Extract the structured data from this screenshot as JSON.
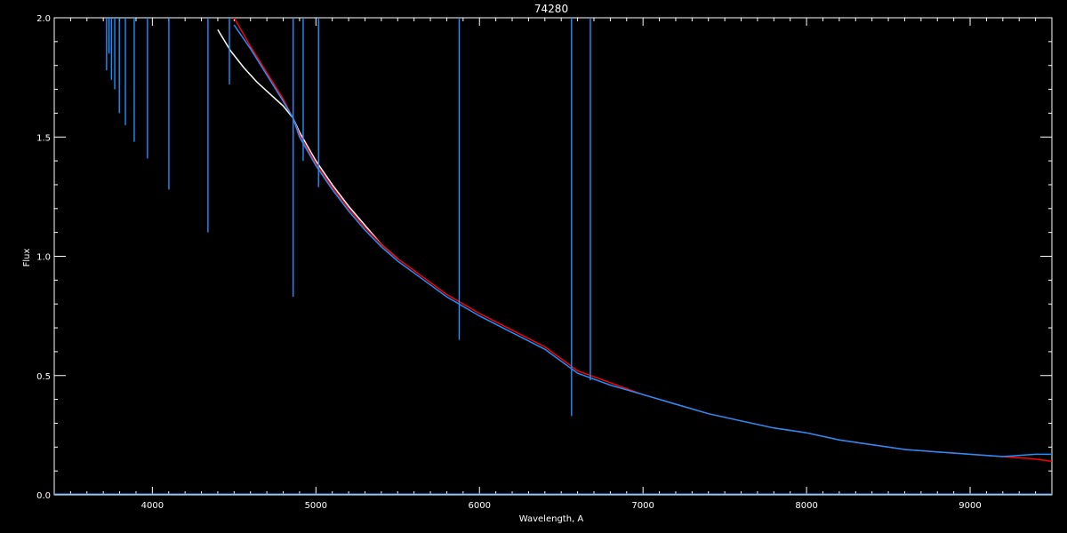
{
  "chart_data": {
    "type": "line",
    "title": "74280",
    "xlabel": "Wavelength, A",
    "ylabel": "Flux",
    "xlim": [
      3400,
      9500
    ],
    "ylim": [
      0.0,
      2.0
    ],
    "x_ticks": [
      4000,
      5000,
      6000,
      7000,
      8000,
      9000
    ],
    "x_tick_labels": [
      "4000",
      "5000",
      "6000",
      "7000",
      "8000",
      "9000"
    ],
    "y_ticks": [
      0.0,
      0.5,
      1.0,
      1.5,
      2.0
    ],
    "y_tick_labels": [
      "0.0",
      "0.5",
      "1.0",
      "1.5",
      "2.0"
    ],
    "grid": false,
    "background": "#000000",
    "series": [
      {
        "color": "#ffffff",
        "x": [
          4400,
          4480,
          4560,
          4640,
          4720,
          4800,
          4860,
          4900,
          5000,
          5100,
          5200,
          5300,
          5400,
          5500
        ],
        "y": [
          1.95,
          1.86,
          1.79,
          1.73,
          1.68,
          1.63,
          1.58,
          1.52,
          1.4,
          1.3,
          1.21,
          1.13,
          1.05,
          0.99
        ]
      },
      {
        "color": "#ff0000",
        "x": [
          4200,
          4300,
          4400,
          4500,
          4600,
          4700,
          4800,
          4860,
          4900,
          5000,
          5100,
          5200,
          5300,
          5400,
          5500,
          5600,
          5700,
          5800,
          5900,
          6000,
          6200,
          6400,
          6600,
          6800,
          7000,
          7200,
          7400,
          7600,
          7800,
          8000,
          8200,
          8400,
          8600,
          8800,
          9000,
          9200,
          9400,
          9500
        ],
        "y": [
          2.1,
          2.08,
          2.05,
          2.0,
          1.88,
          1.77,
          1.66,
          1.58,
          1.51,
          1.39,
          1.29,
          1.2,
          1.12,
          1.05,
          0.99,
          0.94,
          0.89,
          0.84,
          0.8,
          0.76,
          0.69,
          0.62,
          0.52,
          0.47,
          0.42,
          0.38,
          0.34,
          0.31,
          0.28,
          0.26,
          0.23,
          0.21,
          0.19,
          0.18,
          0.17,
          0.16,
          0.15,
          0.14
        ]
      },
      {
        "color": "#1e90ff",
        "x": [
          4500,
          4600,
          4700,
          4800,
          4860,
          4900,
          5000,
          5100,
          5200,
          5300,
          5400,
          5500,
          5600,
          5700,
          5800,
          5900,
          6000,
          6200,
          6400,
          6600,
          6800,
          7000,
          7200,
          7400,
          7600,
          7800,
          8000,
          8200,
          8400,
          8600,
          8800,
          9000,
          9200,
          9400,
          9500
        ],
        "y": [
          1.97,
          1.87,
          1.76,
          1.65,
          1.58,
          1.5,
          1.38,
          1.28,
          1.19,
          1.11,
          1.04,
          0.98,
          0.93,
          0.88,
          0.83,
          0.79,
          0.75,
          0.68,
          0.61,
          0.51,
          0.46,
          0.42,
          0.38,
          0.34,
          0.31,
          0.28,
          0.26,
          0.23,
          0.21,
          0.19,
          0.18,
          0.17,
          0.16,
          0.17,
          0.17
        ]
      }
    ],
    "absorption_lines": [
      {
        "x": 3720,
        "depth_to": 1.78
      },
      {
        "x": 3735,
        "depth_to": 1.85
      },
      {
        "x": 3750,
        "depth_to": 1.74
      },
      {
        "x": 3770,
        "depth_to": 1.7
      },
      {
        "x": 3798,
        "depth_to": 1.6
      },
      {
        "x": 3835,
        "depth_to": 1.55
      },
      {
        "x": 3889,
        "depth_to": 1.48
      },
      {
        "x": 3970,
        "depth_to": 1.41
      },
      {
        "x": 4101,
        "depth_to": 1.28
      },
      {
        "x": 4340,
        "depth_to": 1.1
      },
      {
        "x": 4471,
        "depth_to": 1.72
      },
      {
        "x": 4861,
        "depth_to": 0.83
      },
      {
        "x": 4922,
        "depth_to": 1.4
      },
      {
        "x": 5016,
        "depth_to": 1.29
      },
      {
        "x": 5876,
        "depth_to": 0.65
      },
      {
        "x": 6563,
        "depth_to": 0.33
      },
      {
        "x": 6678,
        "depth_to": 0.48
      }
    ]
  }
}
